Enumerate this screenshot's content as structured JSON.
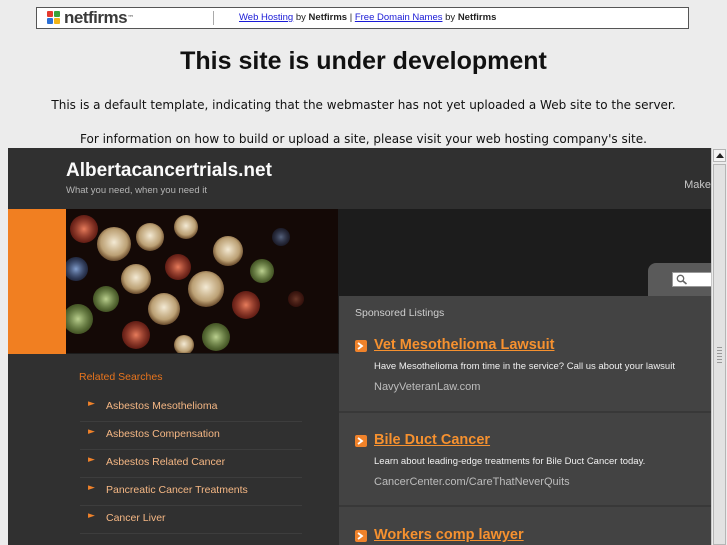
{
  "banner": {
    "logo_text_net": "net",
    "logo_text_firms": "firms",
    "logo_tm": "™",
    "link1": "Web Hosting",
    "by1": "by",
    "brand1": "Netfirms",
    "divider": "|",
    "link2": "Free Domain Names",
    "by2": "by",
    "brand2": "Netfirms"
  },
  "headline": "This site is under development",
  "notice1": "This is a default template, indicating that the webmaster has not yet uploaded a Web site to the server.",
  "notice2": "For information on how to build or upload a site, please visit your web hosting company's site.",
  "site": {
    "title": "Albertacancertrials.net",
    "tagline": "What you need, when you need it",
    "make_text": "Make"
  },
  "sponsored": {
    "heading": "Sponsored Listings",
    "ads": [
      {
        "title": "Vet Mesothelioma Lawsuit",
        "desc": "Have Mesothelioma from time in the service? Call us about your lawsuit",
        "url": "NavyVeteranLaw.com"
      },
      {
        "title": "Bile Duct Cancer",
        "desc": "Learn about leading-edge treatments for Bile Duct Cancer today.",
        "url": "CancerCenter.com/CareThatNeverQuits"
      },
      {
        "title": "Workers comp lawyer",
        "desc": "",
        "url": ""
      }
    ]
  },
  "related": {
    "heading": "Related Searches",
    "items": [
      "Asbestos Mesothelioma",
      "Asbestos Compensation",
      "Asbestos Related Cancer",
      "Pancreatic Cancer Treatments",
      "Cancer Liver"
    ]
  },
  "colors": {
    "accent_orange": "#f17f21",
    "link_orange": "#f6912f",
    "banner_link_blue": "#1a1ad6"
  },
  "icons": {
    "search": "search-icon",
    "ad_arrow": "arrow-right-icon",
    "scroll_up": "scroll-up-arrow-icon"
  }
}
